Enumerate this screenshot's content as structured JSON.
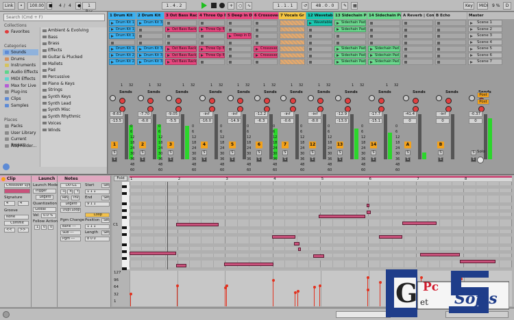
{
  "topbar": {
    "link": "Link",
    "tempo": "100.00",
    "sig_num": "4",
    "sig_sep": "/",
    "sig_den": "4",
    "metro_bar": "1 Bar",
    "position": "1 .   4 .   2",
    "loop_start": "1 .   1 .   1",
    "loop_len": "48 .   0 .   0",
    "key": "Key",
    "midi": "MIDI",
    "cpu": "9 %",
    "dot": "D"
  },
  "browser": {
    "search_placeholder": "Search (Cmd + F)",
    "collections_head": "Collections",
    "favorites": "Favorites",
    "categories_head": "Categories",
    "categories": [
      "Sounds",
      "Drums",
      "Instruments",
      "Audio Effects",
      "MIDI Effects",
      "Max for Live",
      "Plug-ins",
      "Clips",
      "Samples"
    ],
    "places_head": "Places",
    "places": [
      "Packs",
      "User Library",
      "Current Project",
      "Add Folder..."
    ],
    "list_items": [
      "Ambient & Evolving",
      "Bass",
      "Brass",
      "Effects",
      "Guitar & Plucked",
      "Mallets",
      "Pad",
      "Percussive",
      "Piano & Keys",
      "Strings",
      "Synth Keys",
      "Synth Lead",
      "Synth Misc",
      "Synth Rhythmic",
      "Voices",
      "Winds"
    ]
  },
  "tracks": [
    {
      "name": "1 Drum Kit",
      "color": "#3ab0f0",
      "num": "1",
      "clips": [
        "Drum Kit 1",
        "Drum Kit 1",
        "Drum Kit 1",
        "",
        "Drum Kit 1",
        "Drum Kit 2",
        "Drum Kit 2"
      ],
      "vol": "-8.63",
      "vol2": "-13.5"
    },
    {
      "name": "2 Drum Kit",
      "color": "#3ab0f0",
      "num": "2",
      "clips": [
        "Drum Kit 3",
        "",
        "",
        "",
        "Drum Kit 3",
        "Drum Kit 3",
        "Drum Kit 3"
      ],
      "vol": "-7.70",
      "vol2": "-6.0"
    },
    {
      "name": "3 Ost Bass Rack",
      "color": "#e8477f",
      "num": "3",
      "clips": [
        "",
        "Ost Bass Rack",
        "",
        "",
        "Ost Bass Rack",
        "Ost Bass Rack",
        "Ost Bass Rack"
      ],
      "vol": "-9.05",
      "vol2": "-5.5"
    },
    {
      "name": "4 Three Op Ba",
      "color": "#e8477f",
      "num": "4",
      "clips": [
        "",
        "Three Op Ba",
        "",
        "",
        "Three Op Ba",
        "Three Op Ba",
        ""
      ],
      "vol": "-inf",
      "vol2": "-16.0"
    },
    {
      "name": "5 Deep in Dark",
      "color": "#e8477f",
      "num": "5",
      "clips": [
        "",
        "",
        "Deep in Dark",
        "",
        "",
        "",
        ""
      ],
      "vol": "-inf",
      "vol2": "-14.9"
    },
    {
      "name": "6 Crossover Sy",
      "color": "#e8477f",
      "num": "6",
      "clips": [
        "",
        "",
        "",
        "",
        "Crossover Sy",
        "Crossover Sy",
        ""
      ],
      "vol": "-12.2",
      "vol2": "-6.3"
    },
    {
      "name": "7 Vocals Gr",
      "color": "#f4c542",
      "num": "7",
      "clips": [
        "hatch",
        "hatch",
        "hatch",
        "hatch",
        "hatch",
        "hatch",
        "hatch"
      ],
      "vol": "-inf",
      "vol2": "-0.6"
    },
    {
      "name": "12 Wavetable",
      "color": "#18c7b0",
      "num": "12",
      "clips": [
        "Wavetable",
        "",
        "",
        "",
        "",
        "",
        ""
      ],
      "vol": "-inf",
      "vol2": "-8.0"
    },
    {
      "name": "13 Sidechain Pad",
      "color": "#6bd98e",
      "num": "13",
      "clips": [
        "Sidechain Pad",
        "Sidechain Pad",
        "",
        "",
        "Sidechain Pad",
        "Sidechain Pad",
        "Sidechain Pad"
      ],
      "vol": "-12.9",
      "vol2": "-13.0"
    },
    {
      "name": "14 Sidechain Pad",
      "color": "#6bd98e",
      "num": "14",
      "clips": [
        "",
        "",
        "",
        "",
        "Sidechain Pad",
        "Sidechain Pad",
        "Sidechain Pad"
      ],
      "vol": "-17.7",
      "vol2": "-15.1"
    },
    {
      "name": "A Reverb | Compre",
      "color": "#bdbdbd",
      "num": "A",
      "clips": [],
      "vol": "-41.4",
      "vol2": "0"
    },
    {
      "name": "B Echo",
      "color": "#bdbdbd",
      "num": "B",
      "clips": [],
      "vol": "-inf",
      "vol2": "0"
    },
    {
      "name": "Master",
      "color": "#bdbdbd",
      "num": "",
      "clips": [],
      "vol": "-0.37",
      "vol2": "0"
    }
  ],
  "scenes": [
    "Scene 1",
    "Scene 2",
    "Scene 3",
    "Scene 4",
    "Scene 5",
    "Scene 6",
    "Scene 7"
  ],
  "mixer": {
    "sends": "Sends",
    "post": "Post",
    "sbtn": "S",
    "solo_label": "Solo",
    "slot_nums": [
      "1",
      "32"
    ],
    "db_scale": [
      "0",
      "6",
      "12",
      "18",
      "24",
      "30",
      "36",
      "48",
      "60"
    ]
  },
  "clip_panel": {
    "title": "Clip",
    "name": "Crossover Syn",
    "signature": "Signature",
    "sig_num": "4",
    "sig_den": "4",
    "groove": "Groove",
    "groove_val": "None",
    "commit": "Commit",
    "nav_left": "<<",
    "nav_right": ">>"
  },
  "launch_panel": {
    "title": "Launch",
    "launch_mode": "Launch Mode",
    "mode_val": "Trigger",
    "legato": "Legato",
    "quantization": "Quantization",
    "quant_val": "Global",
    "vel": "Vel",
    "vel_val": "0.0 %",
    "follow": "Follow Action",
    "f1": "1",
    "f2": "0",
    "f3": "0"
  },
  "notes_panel": {
    "title": "Notes",
    "range": "D0-G1",
    "start": "Start",
    "set": "Set",
    "rev": "Rev",
    "inv": "Inv",
    "end": "End",
    "legato": "Legato",
    "dupl": "Dupl.Loop",
    "loop": "Loop",
    "position": "Position",
    "length": "Length",
    "pgm": "Pgm Change",
    "bank": "Bank ---",
    "sub": "Sub ---",
    "pgm_val": "Pgm ---",
    "start_val": "1  1  1",
    "end_val": "9  1  1",
    "pos_val": "1  1  1",
    "len_val": "8  0  0"
  },
  "pianoroll": {
    "fold": "Fold",
    "c1": "C1",
    "bar_labels": [
      "1",
      "2",
      "3",
      "4",
      "5",
      "6",
      "7",
      "8"
    ],
    "vel_labels": [
      "127",
      "96",
      "64",
      "32",
      "1"
    ]
  },
  "watermark": {
    "text_a": "Pc",
    "text_b": "Softs",
    "letter": "G",
    "sub": "et"
  }
}
